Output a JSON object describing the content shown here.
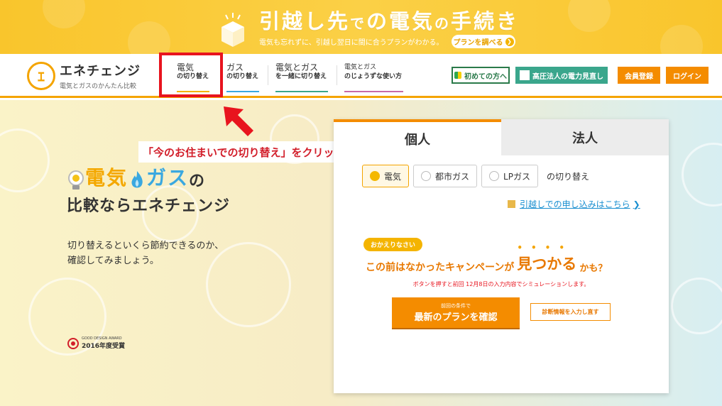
{
  "banner": {
    "title_a": "引越し先",
    "title_b": "で",
    "title_c": "の電気",
    "title_d": "の",
    "title_e": "手続き",
    "subtitle": "電気も忘れずに、引越し翌日に間に合うプランがわかる。",
    "button_label": "プランを調べる",
    "button_arrow": "❯"
  },
  "logo": {
    "mark": "ｴ",
    "name": "エネチェンジ",
    "tagline": "電気とガスのかんたん比較"
  },
  "nav": {
    "items": [
      {
        "l1": "電気",
        "l2": "の切り替え"
      },
      {
        "l1": "ガス",
        "l2": "の切り替え"
      },
      {
        "l1": "電気とガス",
        "l2": "を一緒に切り替え"
      },
      {
        "l1": "電気とガス",
        "l2": "のじょうずな使い方"
      }
    ]
  },
  "header_buttons": {
    "first_time": "初めての方へ",
    "corporate": "高圧法人の電力見直し",
    "register": "会員登録",
    "login": "ログイン"
  },
  "callout": "「今のお住まいでの切り替え」をクリック",
  "hero": {
    "denki": "電気",
    "gas": "ガス",
    "no": "の",
    "line2": "比較ならエネチェンジ",
    "desc1": "切り替えるといくら節約できるのか、",
    "desc2": "確認してみましょう。",
    "award_small": "GOOD DESIGN AWARD",
    "award_year": "2016年度受賞"
  },
  "panel": {
    "tab_personal": "個人",
    "tab_corp": "法人",
    "radios": [
      "電気",
      "都市ガス",
      "LPガス"
    ],
    "radio_suffix": "の切り替え",
    "moving_link": "引越しでの申し込みはこちら",
    "link_chev": "❯",
    "welcome": "おかえりなさい",
    "campaign_1": "この前はなかったキャンペーンが",
    "campaign_2": "見つかる",
    "campaign_3": "かも？",
    "campaign_dots": "••••",
    "sim_note": "ボタンを押すと前回 12月8日の入力内容でシミュレーションします。",
    "confirm_small": "前回の条件で",
    "confirm_big": "最新のプランを確認",
    "reinput": "診断情報を入力し直す"
  },
  "colors": {
    "accent": "#f48c00",
    "banner": "#f9c52c",
    "gas_blue": "#3aa8e0",
    "highlight_red": "#e8141e"
  }
}
